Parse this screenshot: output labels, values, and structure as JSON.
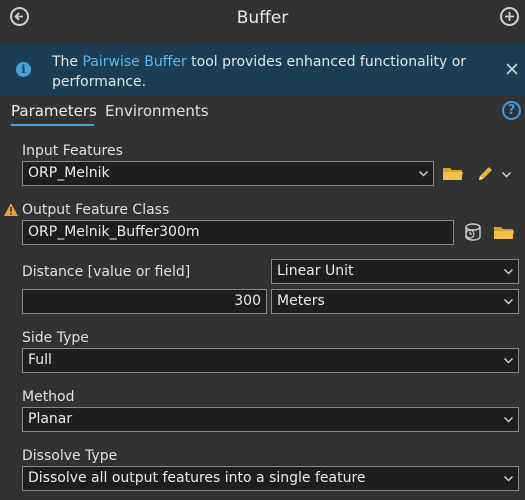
{
  "window": {
    "title": "Buffer"
  },
  "info": {
    "prefix": "The ",
    "link": "Pairwise Buffer",
    "suffix": " tool provides enhanced functionality or performance."
  },
  "tabs": {
    "parameters": "Parameters",
    "environments": "Environments"
  },
  "params": {
    "input_features": {
      "label": "Input Features",
      "value": "ORP_Melnik"
    },
    "output_feature_class": {
      "label": "Output Feature Class",
      "value": "ORP_Melnik_Buffer300m"
    },
    "distance": {
      "label": "Distance [value or field]",
      "type": "Linear Unit",
      "value": "300",
      "unit": "Meters"
    },
    "side_type": {
      "label": "Side Type",
      "value": "Full"
    },
    "method": {
      "label": "Method",
      "value": "Planar"
    },
    "dissolve_type": {
      "label": "Dissolve Type",
      "value": "Dissolve all output features into a single feature"
    }
  },
  "icons": {
    "back": "back-arrow-icon",
    "add": "add-icon",
    "info": "info-icon",
    "close": "close-icon",
    "help": "help-icon",
    "folder": "folder-icon",
    "pencil": "pencil-icon",
    "warning": "warning-icon",
    "database": "database-icon"
  },
  "colors": {
    "accent": "#4aa2dc",
    "info_bg": "#1c3e55",
    "link": "#5fb4f0",
    "warning": "#e8a33a"
  }
}
